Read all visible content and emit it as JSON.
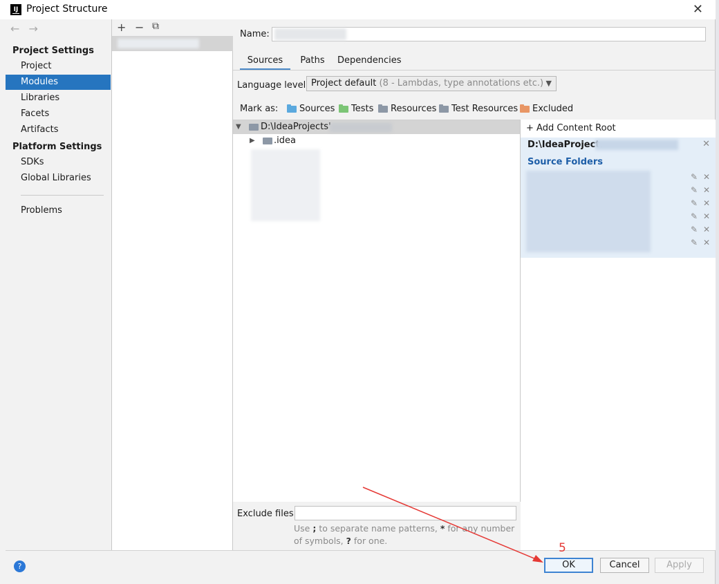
{
  "window": {
    "title": "Project Structure",
    "app_icon": "intellij-icon"
  },
  "sidebar": {
    "nav_back": "←",
    "nav_forward": "→",
    "sections": [
      {
        "title": "Project Settings",
        "items": [
          "Project",
          "Modules",
          "Libraries",
          "Facets",
          "Artifacts"
        ]
      },
      {
        "title": "Platform Settings",
        "items": [
          "SDKs",
          "Global Libraries"
        ]
      }
    ],
    "problems": "Problems",
    "selected": "Modules"
  },
  "modules_toolbar": {
    "add": "+",
    "remove": "−",
    "copy": "⧉"
  },
  "module_editor": {
    "name_label": "Name:",
    "name_value": "",
    "tabs": [
      "Sources",
      "Paths",
      "Dependencies"
    ],
    "active_tab": "Sources",
    "language_level_label": "Language level:",
    "language_level_value": "Project default",
    "language_level_hint": "(8 - Lambdas, type annotations etc.)",
    "mark_as_label": "Mark as:",
    "mark_as": [
      {
        "label": "Sources",
        "color": "#5ba9de"
      },
      {
        "label": "Tests",
        "color": "#7cc576"
      },
      {
        "label": "Resources",
        "color": "#8d98a6"
      },
      {
        "label": "Test Resources",
        "color": "#8d98a6"
      },
      {
        "label": "Excluded",
        "color": "#e89665"
      }
    ],
    "tree": [
      {
        "label": "D:\\IdeaProjects'",
        "expanded": true
      },
      {
        "label": ".idea",
        "expanded": false
      }
    ],
    "add_content_root": "Add Content Root",
    "content_root": "D:\\IdeaProject.",
    "source_folders_title": "Source Folders",
    "exclude_label": "Exclude files:",
    "exclude_value": "",
    "exclude_hint_1": "Use",
    "exclude_hint_semicolon": ";",
    "exclude_hint_2": "to separate name patterns,",
    "exclude_hint_star": "*",
    "exclude_hint_3": "for any number of symbols,",
    "exclude_hint_q": "?",
    "exclude_hint_4": "for one."
  },
  "buttons": {
    "help": "?",
    "ok": "OK",
    "cancel": "Cancel",
    "apply": "Apply"
  },
  "annotation": {
    "step": "5",
    "color": "#e53935"
  }
}
